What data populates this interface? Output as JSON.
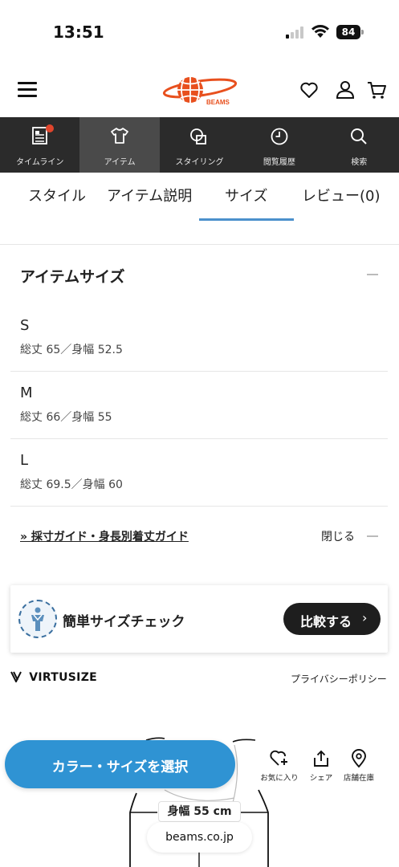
{
  "status_bar": {
    "time": "13:51",
    "battery": "84"
  },
  "header": {
    "brand": "BEAMS",
    "icons": [
      "menu-icon",
      "heart-icon",
      "user-icon",
      "cart-icon"
    ]
  },
  "nav": {
    "items": [
      {
        "label": "タイムライン",
        "icon": "timeline-icon",
        "badge": true
      },
      {
        "label": "アイテム",
        "icon": "tshirt-icon",
        "active": true
      },
      {
        "label": "スタイリング",
        "icon": "styling-icon"
      },
      {
        "label": "閲覧履歴",
        "icon": "clock-icon"
      },
      {
        "label": "検索",
        "icon": "search-icon"
      }
    ]
  },
  "tabs": {
    "items": [
      "スタイル",
      "アイテム説明",
      "サイズ",
      "レビュー(0)"
    ],
    "active": "サイズ",
    "accent_color": "#4b90cc"
  },
  "item_size": {
    "title": "アイテムサイズ",
    "sizes": [
      {
        "name": "S",
        "detail": "総丈 65／身幅 52.5"
      },
      {
        "name": "M",
        "detail": "総丈 66／身幅 55"
      },
      {
        "name": "L",
        "detail": "総丈 69.5／身幅 60"
      }
    ],
    "guide_link": "» 採寸ガイド・身長別着丈ガイド",
    "close_label": "閉じる"
  },
  "size_check": {
    "label": "簡単サイズチェック",
    "compare_button": "比較する",
    "chevron": "›"
  },
  "virtusize": {
    "logo": "VIRTUSIZE",
    "privacy": "プライバシーポリシー"
  },
  "diagram": {
    "measurement": "身幅 55 cm"
  },
  "browser": {
    "domain": "beams.co.jp"
  },
  "actions": {
    "select_button": "カラー・サイズを選択",
    "select_color": "#2f93d3",
    "favorite": "お気に入り",
    "share": "シェア",
    "store_stock": "店舗在庫"
  }
}
